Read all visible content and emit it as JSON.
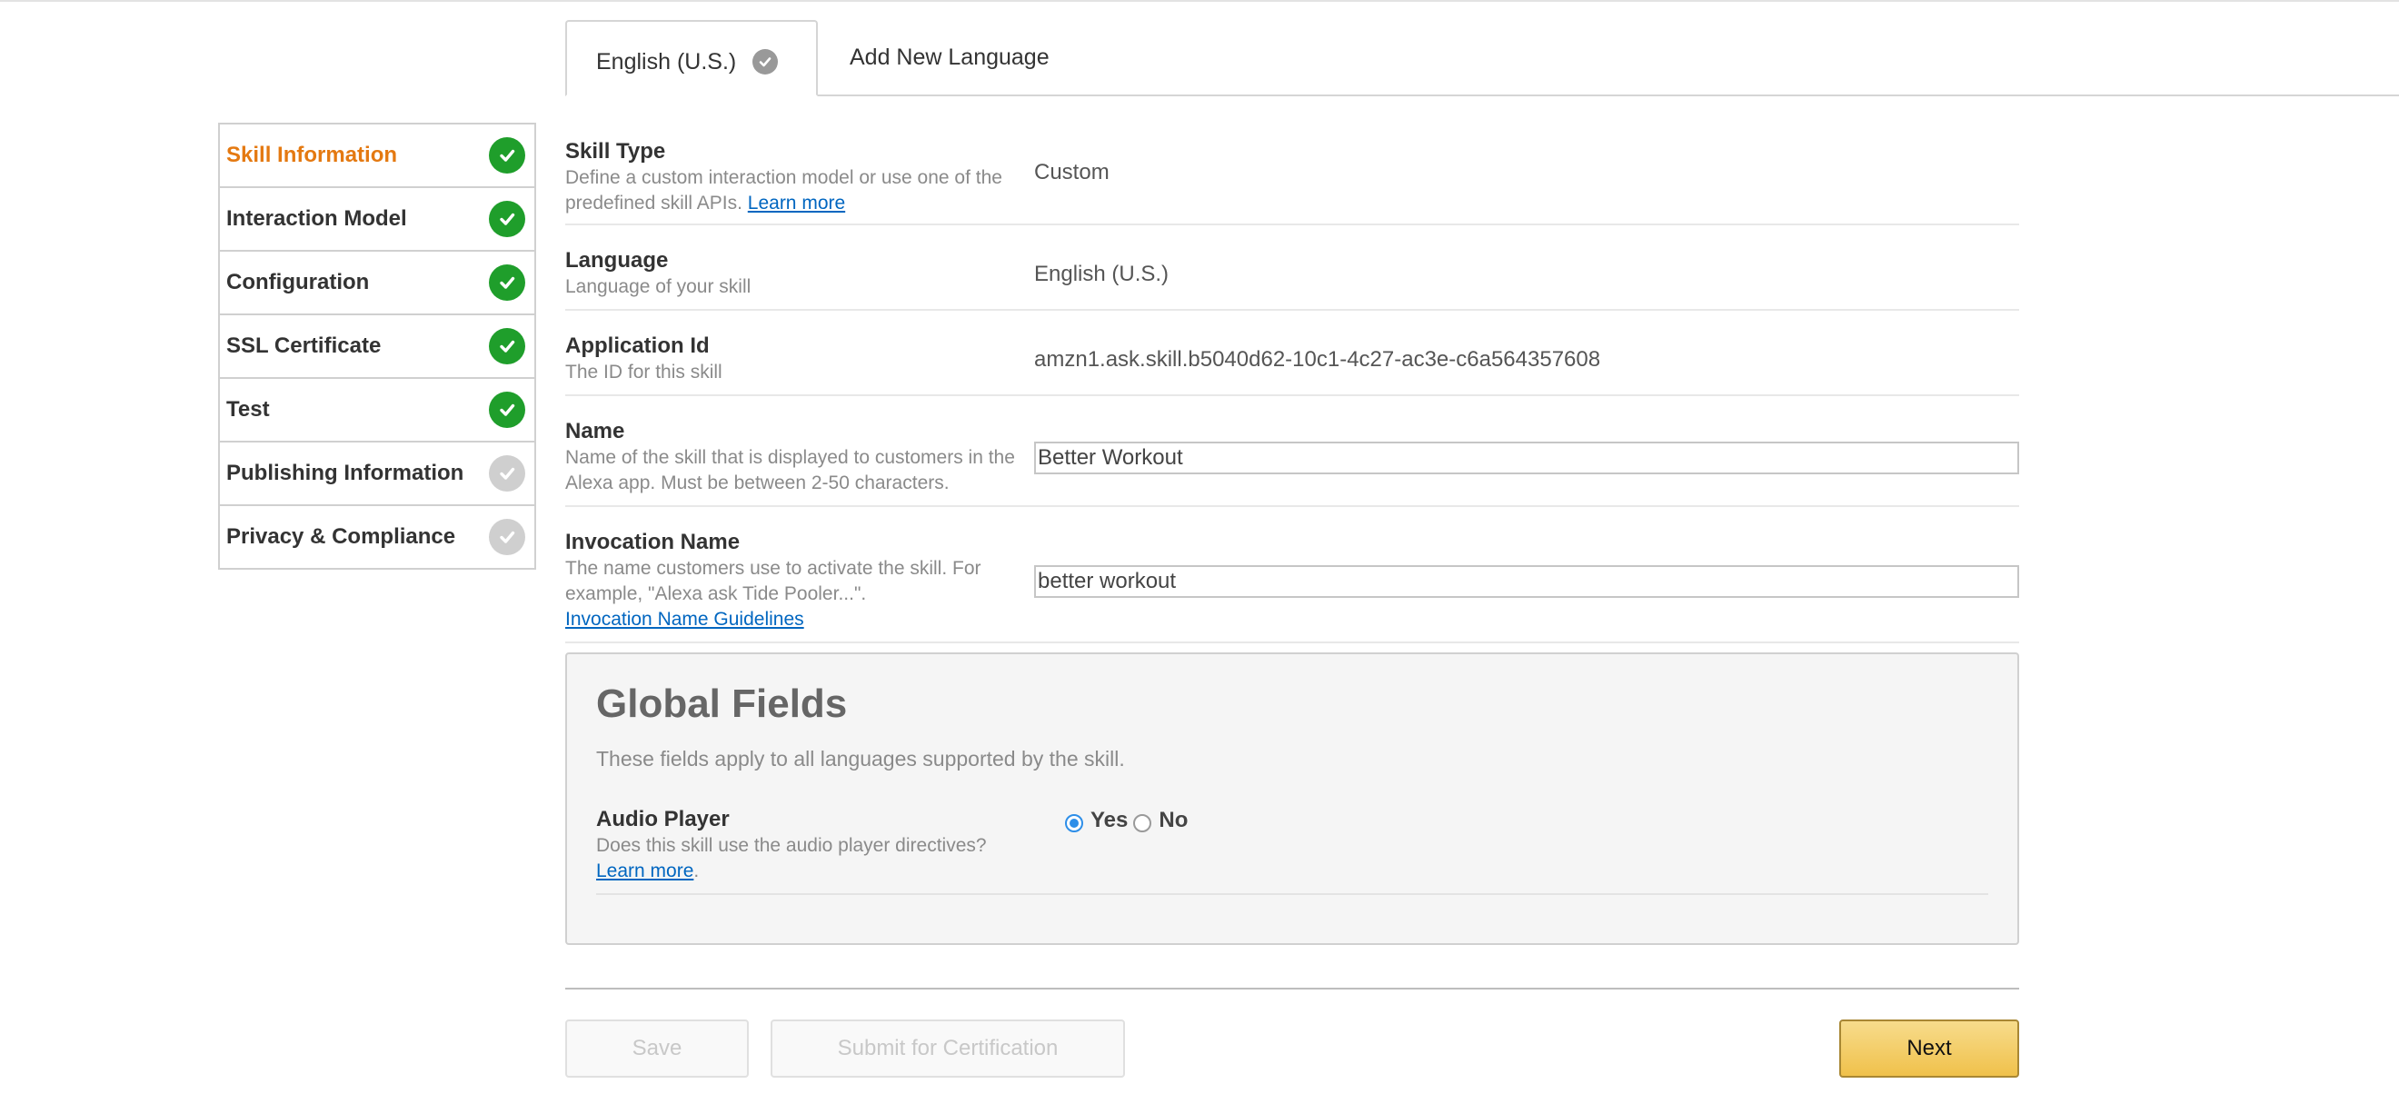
{
  "tabs": {
    "active_label": "English (U.S.)",
    "add_label": "Add New Language"
  },
  "sidebar": {
    "items": [
      {
        "label": "Skill Information",
        "status": "complete",
        "active": true
      },
      {
        "label": "Interaction Model",
        "status": "complete",
        "active": false
      },
      {
        "label": "Configuration",
        "status": "complete",
        "active": false
      },
      {
        "label": "SSL Certificate",
        "status": "complete",
        "active": false
      },
      {
        "label": "Test",
        "status": "complete",
        "active": false
      },
      {
        "label": "Publishing Information",
        "status": "incomplete",
        "active": false
      },
      {
        "label": "Privacy & Compliance",
        "status": "incomplete",
        "active": false
      }
    ]
  },
  "fields": {
    "skill_type": {
      "title": "Skill Type",
      "desc": "Define a custom interaction model or use one of the predefined skill APIs.",
      "link": "Learn more",
      "value": "Custom"
    },
    "language": {
      "title": "Language",
      "desc": "Language of your skill",
      "value": "English (U.S.)"
    },
    "application_id": {
      "title": "Application Id",
      "desc": "The ID for this skill",
      "value": "amzn1.ask.skill.b5040d62-10c1-4c27-ac3e-c6a564357608"
    },
    "name": {
      "title": "Name",
      "desc": "Name of the skill that is displayed to customers in the Alexa app. Must be between 2-50 characters.",
      "value": "Better Workout"
    },
    "invocation_name": {
      "title": "Invocation Name",
      "desc": "The name customers use to activate the skill. For example, \"Alexa ask Tide Pooler...\".",
      "link": "Invocation Name Guidelines",
      "value": "better workout"
    }
  },
  "global_fields": {
    "title": "Global Fields",
    "subtitle": "These fields apply to all languages supported by the skill.",
    "audio_player": {
      "title": "Audio Player",
      "desc": "Does this skill use the audio player directives?",
      "link": "Learn more",
      "link_suffix": ".",
      "options": [
        "Yes",
        "No"
      ],
      "selected": "Yes"
    }
  },
  "buttons": {
    "save": "Save",
    "submit": "Submit for Certification",
    "next": "Next"
  },
  "colors": {
    "active_nav": "#e47911",
    "complete_check": "#1f9e2b",
    "incomplete_check": "#cfcfcf",
    "link": "#0066c0",
    "next_button": "#f0c14b"
  }
}
